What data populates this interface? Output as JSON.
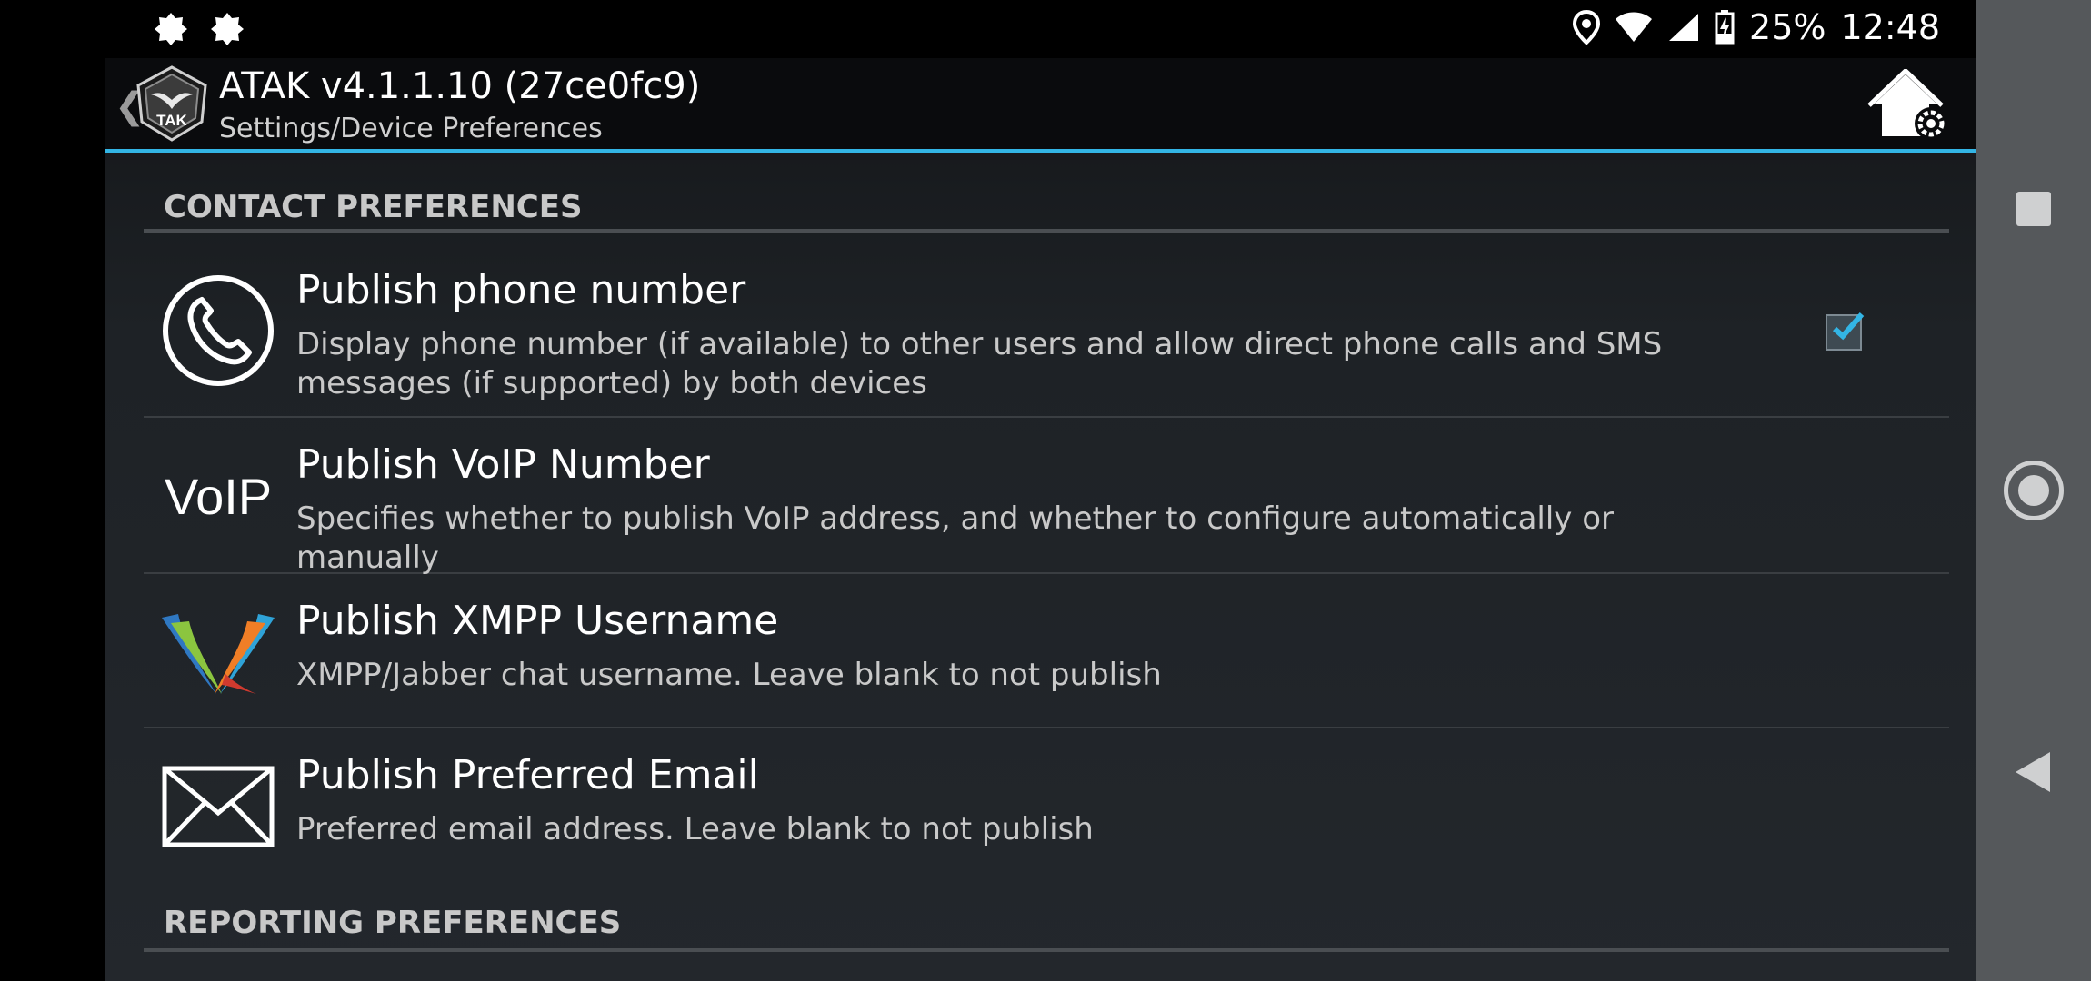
{
  "status_bar": {
    "battery": "25%",
    "time": "12:48",
    "left_icons": [
      "notification-badge-icon",
      "notification-badge-icon"
    ],
    "right_icons": [
      "location-icon",
      "wifi-icon",
      "signal-icon",
      "battery-charging-icon"
    ]
  },
  "action_bar": {
    "title": "ATAK v4.1.1.10 (27ce0fc9)",
    "subtitle": "Settings/Device Preferences",
    "logo_text": "TAK"
  },
  "sections": {
    "contact": {
      "header": "CONTACT PREFERENCES"
    },
    "reporting": {
      "header": "REPORTING PREFERENCES"
    }
  },
  "prefs": [
    {
      "title": "Publish phone number",
      "summary": "Display phone number (if available) to other users and allow direct phone calls and SMS messages (if supported) by both devices",
      "icon": "phone-icon",
      "checked": true
    },
    {
      "title": "Publish VoIP Number",
      "summary": "Specifies whether to publish VoIP address, and whether to configure automatically or manually",
      "icon": "voip-icon",
      "icon_text": "VoIP"
    },
    {
      "title": "Publish XMPP Username",
      "summary": "XMPP/Jabber chat username. Leave blank to not publish",
      "icon": "xmpp-icon"
    },
    {
      "title": "Publish Preferred Email",
      "summary": "Preferred email address. Leave blank to not publish",
      "icon": "email-icon"
    }
  ],
  "colors": {
    "accent": "#33b5e5",
    "checkbox_check": "#33b5e5",
    "nav_bar": "#55585b"
  }
}
